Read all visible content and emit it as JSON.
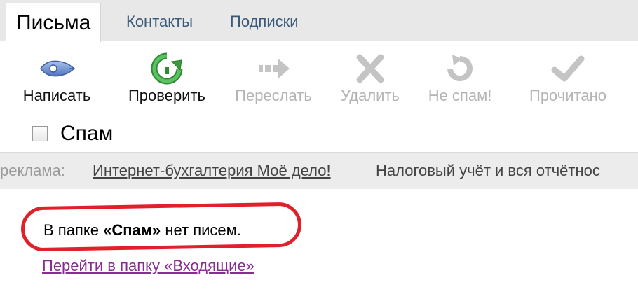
{
  "tabs": [
    {
      "label": "Письма",
      "active": true
    },
    {
      "label": "Контакты",
      "active": false
    },
    {
      "label": "Подписки",
      "active": false
    }
  ],
  "toolbar": {
    "write": {
      "label": "Написать",
      "icon": "pen-icon",
      "enabled": true
    },
    "check": {
      "label": "Проверить",
      "icon": "refresh-icon",
      "enabled": true
    },
    "forward": {
      "label": "Переслать",
      "icon": "forward-arrow-icon",
      "enabled": false
    },
    "delete": {
      "label": "Удалить",
      "icon": "delete-x-icon",
      "enabled": false
    },
    "not_spam": {
      "label": "Не спам!",
      "icon": "undo-icon",
      "enabled": false
    },
    "mark_read": {
      "label": "Прочитано",
      "icon": "checkmark-icon",
      "enabled": false
    }
  },
  "folder": {
    "name": "Спам",
    "checked": false
  },
  "ad": {
    "label": "реклама:",
    "link_text": "Интернет-бухгалтерия Моё дело!",
    "text": "Налоговый учёт и вся отчётнос"
  },
  "empty": {
    "prefix": "В папке ",
    "folder": "«Спам»",
    "suffix": " нет писем.",
    "link": "Перейти в папку «Входящие»"
  },
  "colors": {
    "highlight_ring": "#e0202a",
    "link_visited": "#8a2a93",
    "check_green": "#3c9a3c",
    "pen_blue": "#5c82c8",
    "disabled_gray": "#b4b4b4"
  }
}
